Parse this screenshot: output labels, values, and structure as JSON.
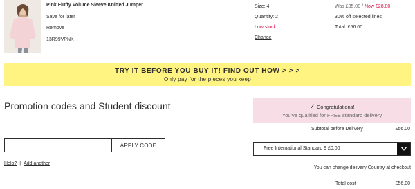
{
  "product": {
    "name": "Pink Fluffy Volume Sleeve Knitted Jumper",
    "save_label": "Save for later",
    "remove_label": "Remove",
    "code": "13R99VPNK",
    "size": "Size: 4",
    "quantity": "Quantity: 2",
    "stock_status": "Low stock",
    "change_label": "Change",
    "price_was": "Was £35.00 /",
    "price_now": "Now £28.00",
    "discount": "30% off selected lines",
    "total": "Total: £56.00"
  },
  "banner": {
    "title": "TRY IT BEFORE YOU BUY IT! FIND OUT HOW > > >",
    "subtitle": "Only pay for the pieces you keep"
  },
  "promo": {
    "title": "Promotion codes and Student discount",
    "input_value": "",
    "apply_label": "APPLY CODE",
    "help_label": "Help?",
    "separator": "|",
    "add_another_label": "Add another"
  },
  "summary": {
    "congrats_title": "Congratulations!",
    "congrats_text": "You've qualified for FREE standard delivery",
    "subtotal_label": "Subtotal before Delivery",
    "subtotal_value": "£56.00",
    "delivery_option": "Free International Standard 9 £0.00",
    "delivery_note": "You can change delivery Country at checkout",
    "total_label": "Total cost",
    "total_value": "£56.00"
  },
  "colors": {
    "banner_bg": "#fff382",
    "accent_red": "#d01345",
    "congrats_bg": "#f6dde6"
  }
}
